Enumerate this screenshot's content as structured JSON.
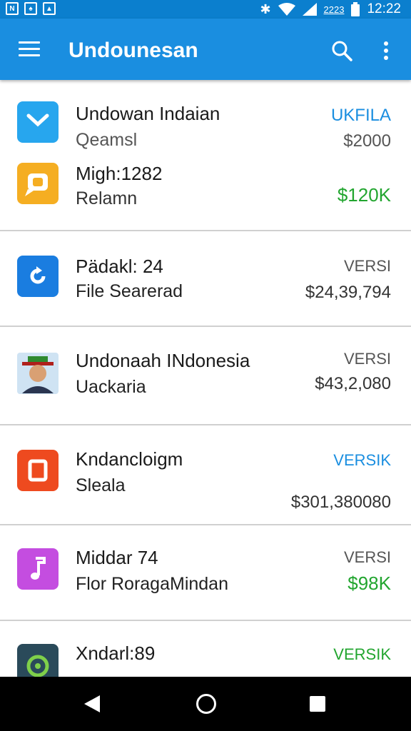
{
  "status_bar": {
    "time": "12:22",
    "battery_text": "2223"
  },
  "app_bar": {
    "title": "Undounesan"
  },
  "rows": [
    {
      "title": "Undowan Indaian",
      "subtitle": "Qeamsl",
      "right_top": "UKFILA",
      "right_top_color": "#1a8ee0",
      "right_bottom": "$2000",
      "right_bottom_color": "#555555",
      "icon": "chat-bubble-icon",
      "icon_bg": "#27a6ee",
      "title2": "Migh:1282",
      "subtitle2": "Relamn",
      "right_bottom2": "$120K",
      "right_bottom2_color": "#22a52f",
      "icon2": "message-bubble-icon",
      "icon2_bg": "#f5ae22"
    },
    {
      "title": "Pädakl: 24",
      "subtitle": "File Searerad",
      "right_top": "VERSI",
      "right_top_color": "#555555",
      "right_bottom": "$24,39,794",
      "right_bottom_color": "#333333",
      "icon": "refresh-icon",
      "icon_bg": "#1a7de0"
    },
    {
      "title": "Undonaah INdonesia",
      "subtitle": "Uackaria",
      "right_top": "VERSI",
      "right_top_color": "#555555",
      "right_bottom": "$43,2,080",
      "right_bottom_color": "#333333",
      "icon": "person-avatar-icon",
      "icon_bg": "#cfe3f3"
    },
    {
      "title": "Kndancloigm",
      "subtitle": "Sleala",
      "right_top": "VERSIK",
      "right_top_color": "#1a8ee0",
      "right_bottom": "$301,380080",
      "right_bottom_color": "#333333",
      "icon": "document-icon",
      "icon_bg": "#ee4a1f"
    },
    {
      "title": "Middar 74",
      "subtitle": "Flor RoragaMindan",
      "right_top": "VERSI",
      "right_top_color": "#555555",
      "right_bottom": "$98K",
      "right_bottom_color": "#22a52f",
      "icon": "music-note-icon",
      "icon_bg": "#c44de0"
    },
    {
      "title": "Xndarl:89",
      "subtitle": "",
      "right_top": "VERSIK",
      "right_top_color": "#22a52f",
      "right_bottom": "",
      "right_bottom_color": "#22a52f",
      "icon": "timer-icon",
      "icon_bg": "#2a4a5a"
    }
  ]
}
